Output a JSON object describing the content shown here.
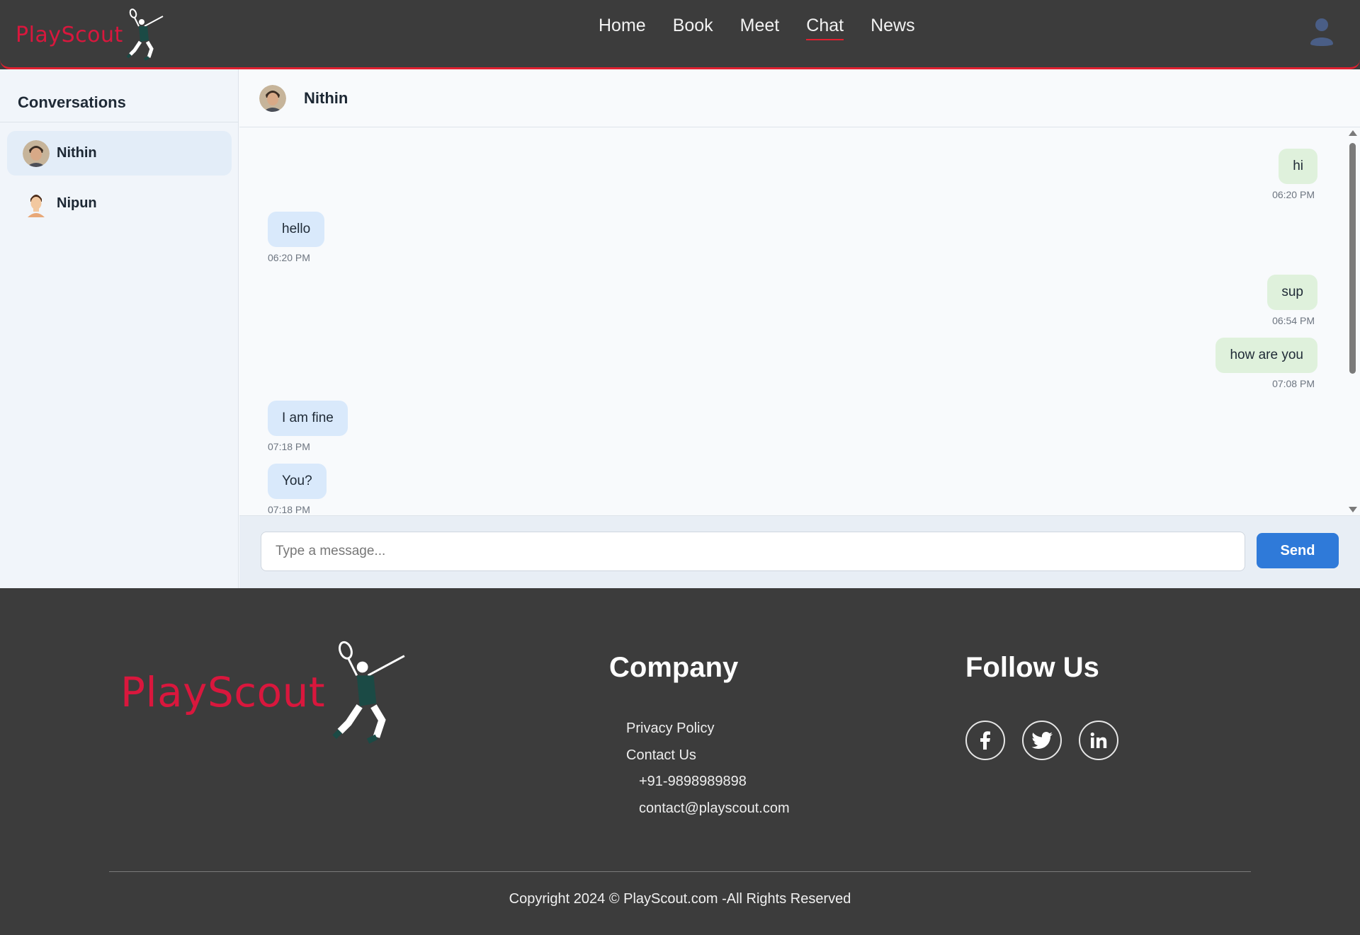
{
  "brand": {
    "name": "PlayScout",
    "accent": "#d9173d",
    "nav_border": "#e02030"
  },
  "nav": {
    "items": [
      {
        "label": "Home"
      },
      {
        "label": "Book"
      },
      {
        "label": "Meet"
      },
      {
        "label": "Chat"
      },
      {
        "label": "News"
      }
    ],
    "active": "Chat",
    "profile_icon": "user-icon"
  },
  "sidebar": {
    "title": "Conversations",
    "conversations": [
      {
        "name": "Nithin",
        "active": true
      },
      {
        "name": "Nipun",
        "active": false
      }
    ]
  },
  "chat": {
    "contact_name": "Nithin",
    "messages": [
      {
        "text": "hi",
        "time": "06:20 PM",
        "direction": "sent"
      },
      {
        "text": "hello",
        "time": "06:20 PM",
        "direction": "received"
      },
      {
        "text": "sup",
        "time": "06:54 PM",
        "direction": "sent"
      },
      {
        "text": "how are you",
        "time": "07:08 PM",
        "direction": "sent"
      },
      {
        "text": "I am fine",
        "time": "07:18 PM",
        "direction": "received"
      },
      {
        "text": "You?",
        "time": "07:18 PM",
        "direction": "received"
      }
    ],
    "input_placeholder": "Type a message...",
    "send_label": "Send",
    "colors": {
      "sent_bubble": "#dff1dc",
      "received_bubble": "#d9e9fb",
      "send_button": "#2f7ad9"
    }
  },
  "footer": {
    "brand": "PlayScout",
    "company_heading": "Company",
    "company_links": [
      {
        "label": "Privacy Policy"
      },
      {
        "label": "Contact Us"
      }
    ],
    "contact": {
      "phone": "+91-9898989898",
      "email": "contact@playscout.com"
    },
    "follow_heading": "Follow Us",
    "social": [
      {
        "icon": "facebook-icon"
      },
      {
        "icon": "twitter-icon"
      },
      {
        "icon": "linkedin-icon"
      }
    ],
    "copyright": "Copyright 2024 © PlayScout.com -All Rights Reserved"
  }
}
